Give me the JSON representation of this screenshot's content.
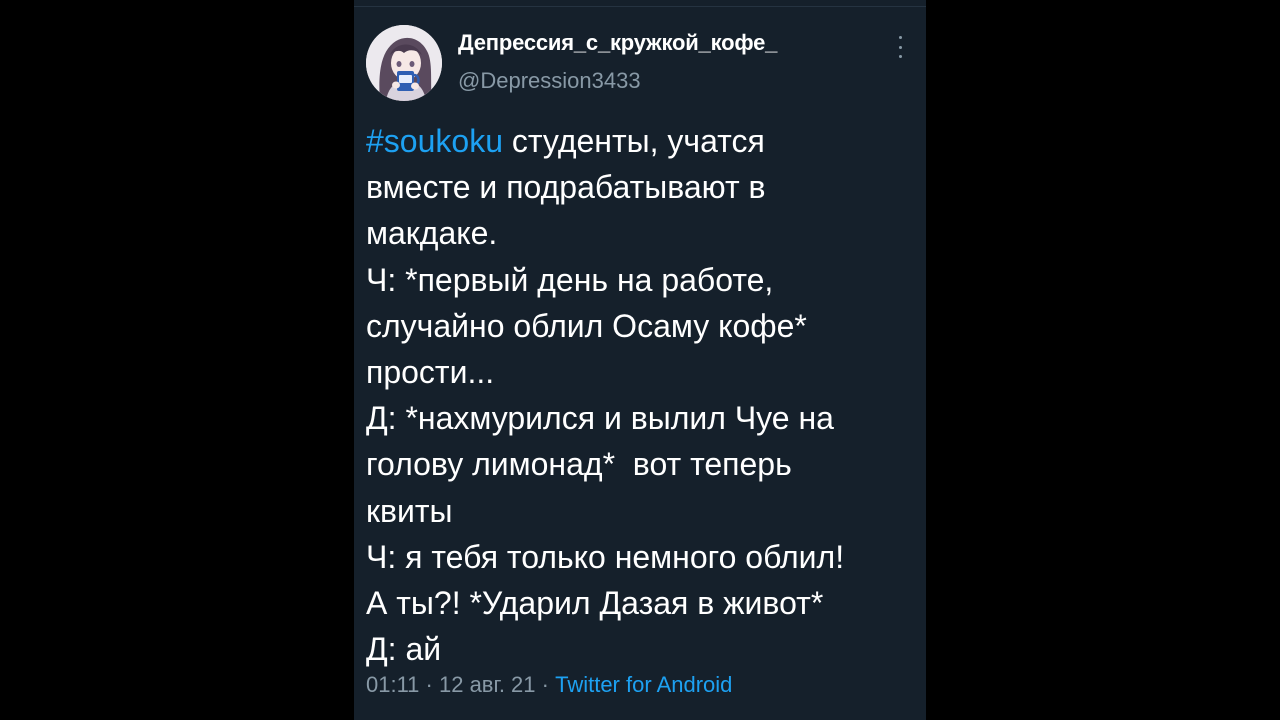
{
  "tweet": {
    "author": {
      "display_name": "Депрессия_с_кружкой_кофе_",
      "handle": "@Depression3433",
      "avatar_icon": "anime-girl-with-mug-avatar"
    },
    "more_icon": "more-vertical-icon",
    "hashtag": "#soukoku",
    "text_first_line_rest": " студенты, учатся",
    "text_rest": "вместе и подрабатывают в\nмакдаке.\nЧ: *первый день на работе,\nслучайно облил Осаму кофе*\nпрости...\nД: *нахмурился и вылил Чуе на\nголову лимонад*  вот теперь\nквиты\nЧ: я тебя только немного облил!\nА ты?! *Ударил Дазая в живот*\nД: ай",
    "time": "01:11",
    "separator": " · ",
    "date": "12 авг. 21",
    "source": "Twitter for Android"
  },
  "colors": {
    "background": "#15202b",
    "outer": "#000000",
    "text": "#ffffff",
    "secondary": "#8899a6",
    "link": "#1da1f2"
  }
}
